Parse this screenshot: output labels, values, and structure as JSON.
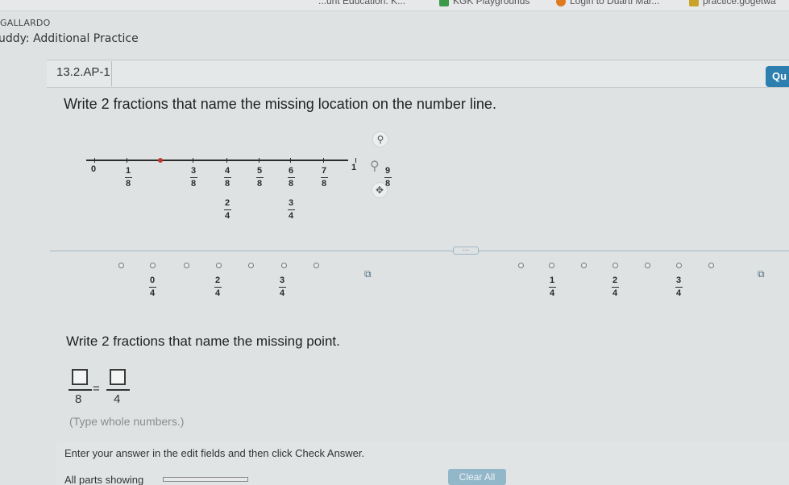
{
  "browser": {
    "bookmarks": [
      {
        "label": "...unt Education: K...",
        "icon": "bookmark-icon",
        "color": "#c9a227"
      },
      {
        "label": "KGK Playgrounds",
        "icon": "playground-icon",
        "color": "#3a9a4a"
      },
      {
        "label": "Login to Duarti Mar...",
        "icon": "login-icon",
        "color": "#e07a1f"
      },
      {
        "label": "practice.gogetwa",
        "icon": "w-icon",
        "color": "#c9a227"
      }
    ]
  },
  "header": {
    "breadcrumb": "GALLARDO",
    "assignment_title": "uddy: Additional Practice"
  },
  "question": {
    "id": "13.2.AP-1",
    "button_label": "Qu",
    "prompt": "Write 2 fractions that name the missing location on the number line."
  },
  "number_line": {
    "start_label": "0",
    "end_label": "1",
    "eighths": [
      {
        "num": "1",
        "den": "8"
      },
      {
        "num": "3",
        "den": "8"
      },
      {
        "num": "4",
        "den": "8"
      },
      {
        "num": "5",
        "den": "8"
      },
      {
        "num": "6",
        "den": "8"
      },
      {
        "num": "7",
        "den": "8"
      }
    ],
    "fourths": [
      {
        "num": "2",
        "den": "4"
      },
      {
        "num": "3",
        "den": "4"
      }
    ],
    "extra_label": {
      "num": "9",
      "den": "8"
    },
    "missing_point_fraction": 0.25
  },
  "choices": {
    "left": [
      {
        "num": "0",
        "den": "4"
      },
      {
        "num": "2",
        "den": "4"
      },
      {
        "num": "3",
        "den": "4"
      }
    ],
    "right": [
      {
        "num": "1",
        "den": "4"
      },
      {
        "num": "2",
        "den": "4"
      },
      {
        "num": "3",
        "den": "4"
      }
    ]
  },
  "answer": {
    "instruction": "Write 2 fractions that name the missing point.",
    "den1": "8",
    "den2": "4",
    "equals": "=",
    "hint": "(Type whole numbers.)"
  },
  "footer": {
    "instructions": "Enter your answer in the edit fields and then click Check Answer.",
    "parts_label": "All parts showing",
    "clear_all": "Clear All"
  },
  "colors": {
    "accent": "#2c7fae",
    "red_dot": "#c0392b"
  }
}
